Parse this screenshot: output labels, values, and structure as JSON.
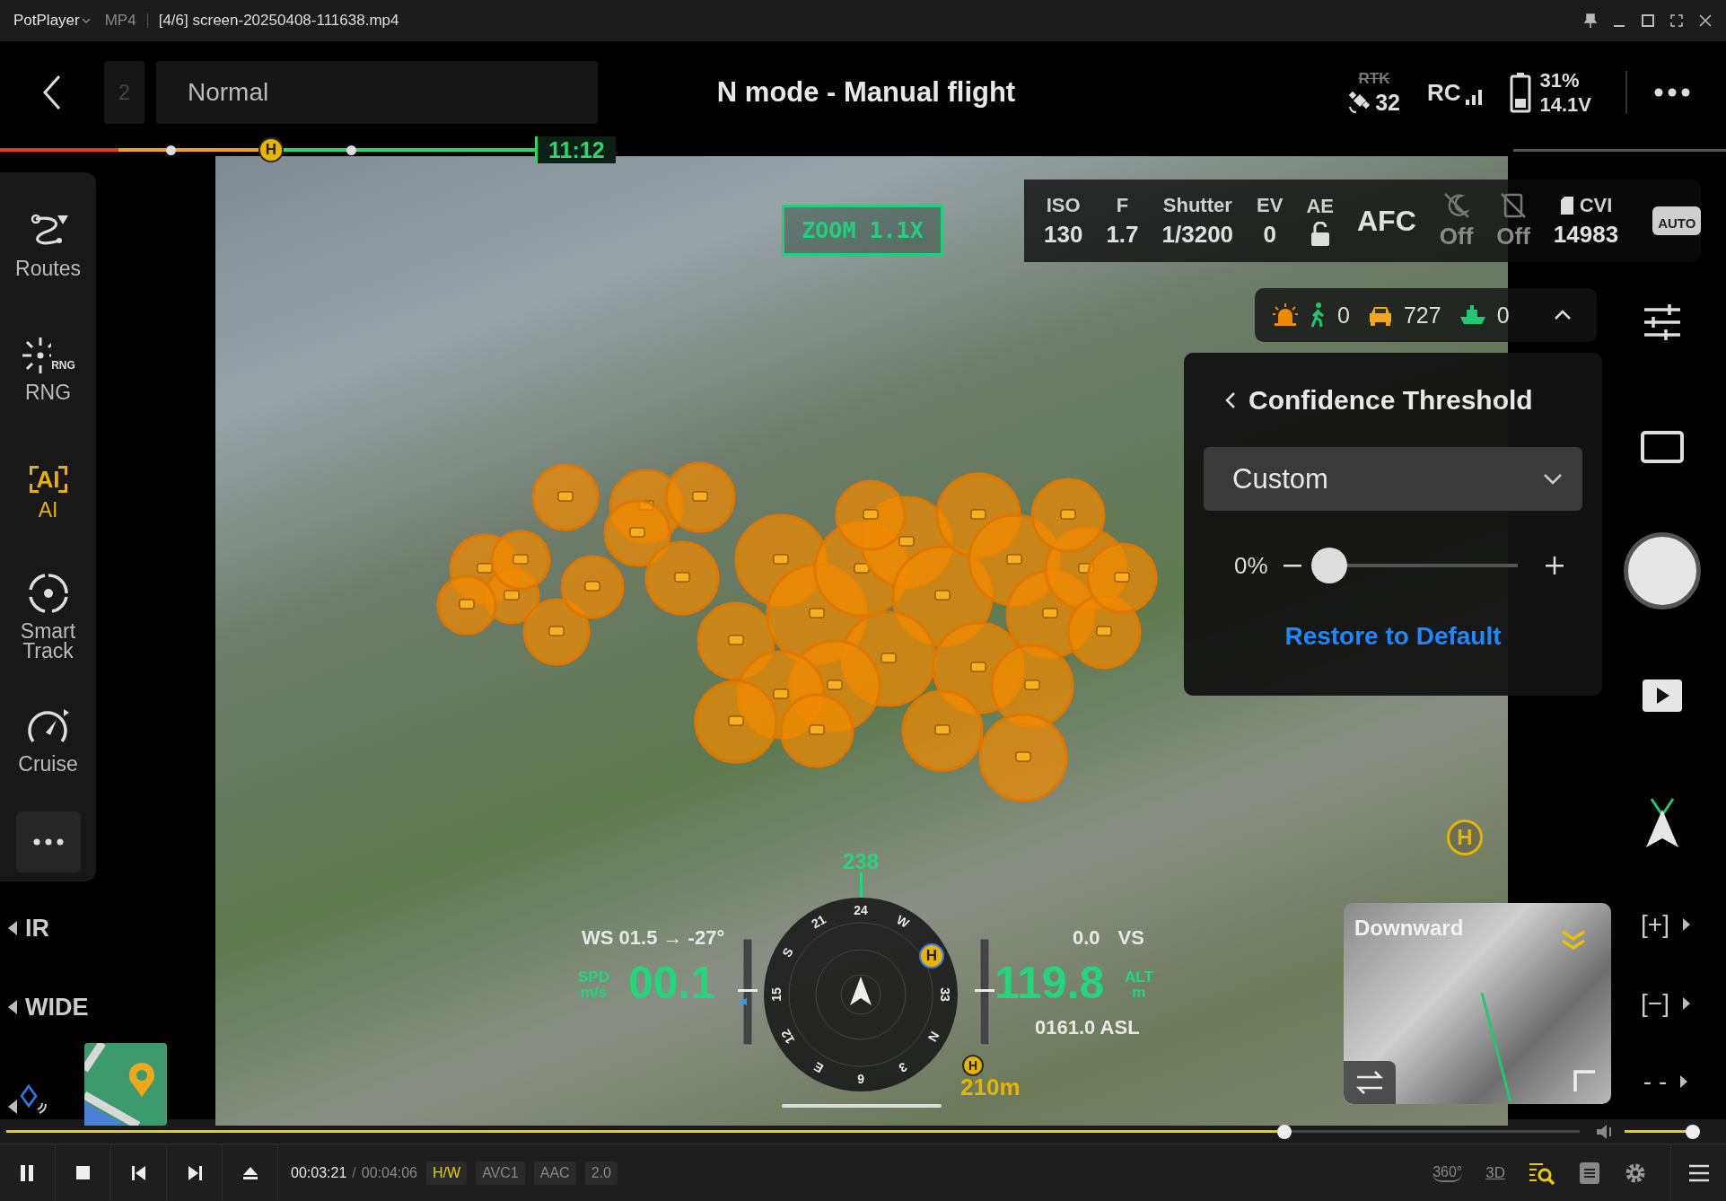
{
  "player_title_bar": {
    "app_name": "PotPlayer",
    "format": "MP4",
    "file_title": "[4/6] screen-20250408-111638.mp4"
  },
  "top_bar": {
    "route_number": "2",
    "mode_label": "Normal",
    "flight_mode": "N mode - Manual flight",
    "rtk": "RTK",
    "satellites": "32",
    "rc": "RC",
    "battery_percent": "31%",
    "battery_voltage": "14.1V"
  },
  "flight_progress": {
    "home_marker": "H",
    "remaining_time": "11:12"
  },
  "sidebar": {
    "items": [
      {
        "kind": "routes",
        "label": "Routes",
        "selected": false
      },
      {
        "kind": "rng",
        "label": "RNG",
        "icon_text": "RNG",
        "selected": false
      },
      {
        "kind": "ai",
        "label": "AI",
        "icon_text": "AI",
        "selected": true
      },
      {
        "kind": "track",
        "label": "Smart Track",
        "selected": false
      },
      {
        "kind": "cruise",
        "label": "Cruise",
        "selected": false
      },
      {
        "kind": "more",
        "selected": false
      }
    ]
  },
  "lens_list": [
    {
      "kind": "text",
      "label": "IR"
    },
    {
      "kind": "text",
      "label": "WIDE"
    },
    {
      "kind": "rangefinder"
    }
  ],
  "camera_params": {
    "settings": [
      {
        "name": "ISO",
        "value": "130"
      },
      {
        "name": "F",
        "value": "1.7"
      },
      {
        "name": "Shutter",
        "value": "1/3200"
      },
      {
        "name": "EV",
        "value": "0"
      }
    ],
    "ae_label": "AE",
    "ae_locked": false,
    "focus_mode": "AFC",
    "night_mode": "Off",
    "second_toggle": "Off",
    "storage_label": "CVI",
    "storage_remaining": "14983",
    "camera_mode_badge": "AUTO"
  },
  "ai_detection": {
    "expanded": true,
    "counts": [
      {
        "kind": "person",
        "count": "0"
      },
      {
        "kind": "vehicle",
        "count": "727"
      },
      {
        "kind": "boat",
        "count": "0"
      }
    ]
  },
  "zoom_label": "ZOOM 1.1X",
  "confidence_panel": {
    "title": "Confidence Threshold",
    "preset": "Custom",
    "value": "0%",
    "level": 0,
    "restore_button": "Restore to Default"
  },
  "hud": {
    "heading": "238",
    "compass_labels": [
      "24",
      "W",
      "33",
      "N",
      "3",
      "6",
      "E",
      "12",
      "15",
      "S",
      "21"
    ],
    "compass_home": "H",
    "wind": "WS 01.5 → -27°",
    "speed_label": "SPD",
    "speed_unit": "m/s",
    "speed": "00.1",
    "vertical_speed": "0.0",
    "vs_label": "VS",
    "altitude": "119.8",
    "alt_label": "ALT",
    "alt_unit": "m",
    "asl": "0161.0 ASL",
    "home_marker": "H",
    "home_distance": "210m"
  },
  "map_home_marker": "H",
  "downward_view": {
    "label": "Downward"
  },
  "zoom_controls": [
    {
      "label": "[+]"
    },
    {
      "label": "[−]"
    },
    {
      "label": "- -"
    }
  ],
  "player_controls": {
    "seek": {
      "level": 0.815
    },
    "volume": {
      "level": 1
    },
    "current_time": "00:03:21",
    "separator": "/",
    "total_time": "00:04:06",
    "badges": [
      {
        "label": "H/W",
        "active": true
      },
      {
        "label": "AVC1",
        "active": false
      },
      {
        "label": "AAC",
        "active": false
      },
      {
        "label": "2.0",
        "active": false
      }
    ],
    "view_360": "360°",
    "view_3d": "3D"
  }
}
